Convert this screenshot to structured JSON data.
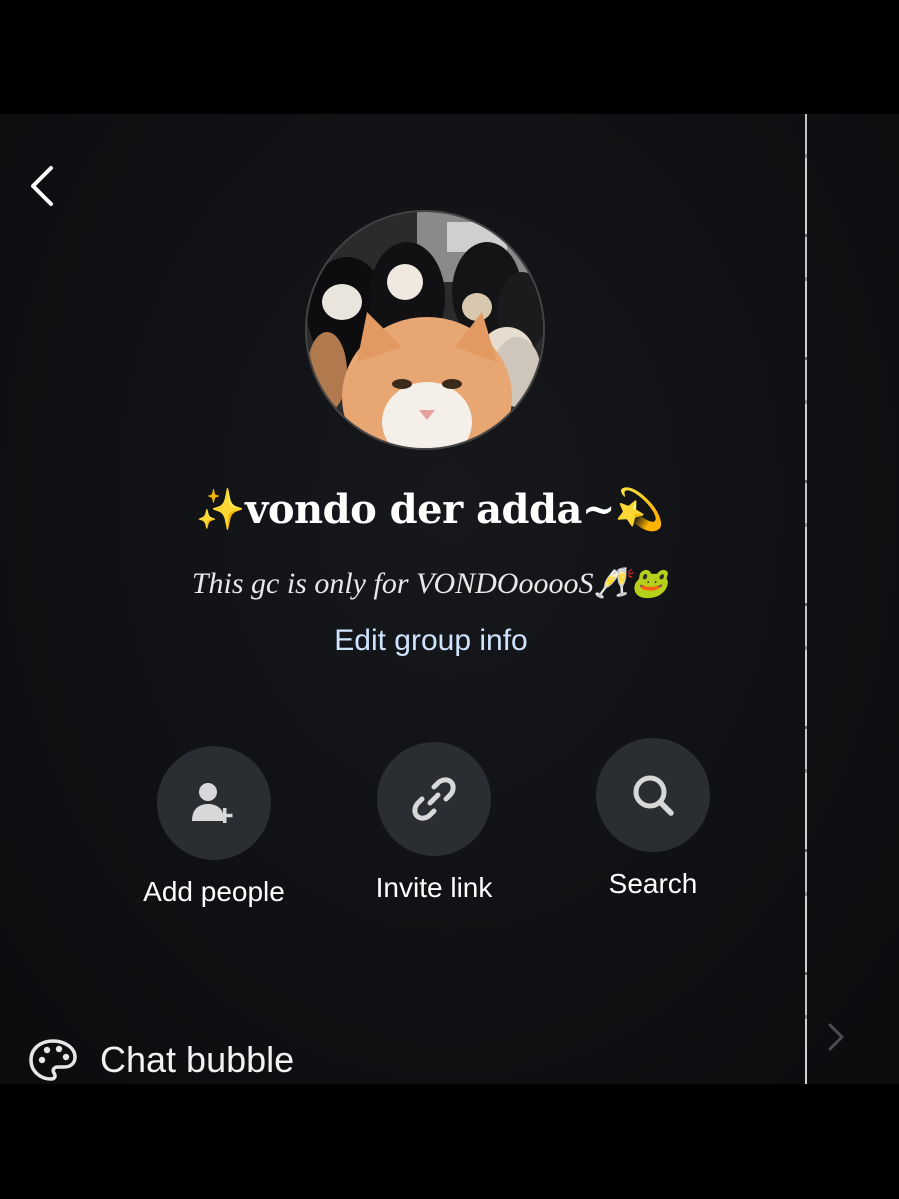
{
  "header": {
    "back_icon": "chevron-left-icon"
  },
  "group": {
    "title": "✨vondo der adda~💫",
    "description": "This gc is only for VONDOooooS🥂🐸",
    "edit_link": "Edit group info"
  },
  "actions": [
    {
      "label": "Add people",
      "icon": "add-person-icon"
    },
    {
      "label": "Invite link",
      "icon": "link-icon"
    },
    {
      "label": "Search",
      "icon": "search-icon"
    }
  ],
  "settings": {
    "chat_bubble_label": "Chat bubble",
    "chat_bubble_icon": "palette-icon"
  },
  "colors": {
    "background": "#0f1114",
    "button_bg": "#2a2d31",
    "link": "#cfe3ff",
    "text": "#ffffff"
  }
}
